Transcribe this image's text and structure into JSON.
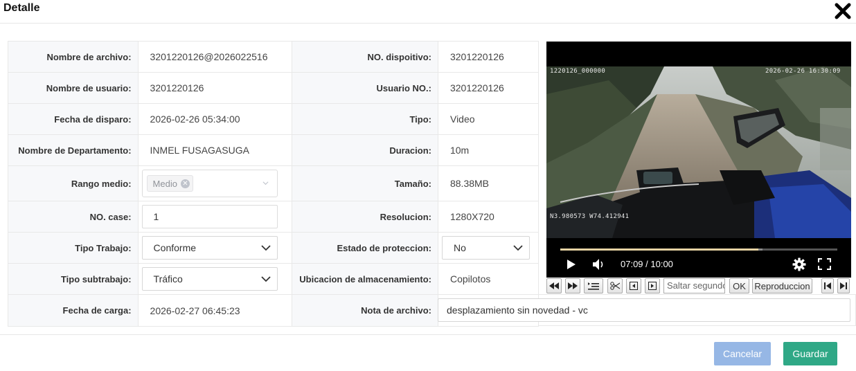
{
  "dialog": {
    "title": "Detalle",
    "close_icon": "close-x-icon"
  },
  "labels": {
    "file_name": "Nombre de archivo:",
    "device_no": "NO. dispoitivo:",
    "user_name": "Nombre de usuario:",
    "user_no": "Usuario NO.:",
    "shot_date": "Fecha de disparo:",
    "type": "Tipo:",
    "department": "Nombre de Departamento:",
    "duration": "Duracion:",
    "media_range": "Rango medio:",
    "size": "Tamaño:",
    "case_no": "NO. case:",
    "resolution": "Resolucion:",
    "work_type": "Tipo Trabajo:",
    "protection": "Estado de proteccion:",
    "subwork_type": "Tipo subtrabajo:",
    "storage": "Ubicacion de almacenamiento:",
    "upload_date": "Fecha de carga:",
    "file_note": "Nota de archivo:"
  },
  "values": {
    "file_name": "3201220126@2026022516",
    "device_no": "3201220126",
    "user_name": "3201220126",
    "user_no": "3201220126",
    "shot_date": "2026-02-26 05:34:00",
    "type": "Video",
    "department": "INMEL FUSAGASUGA",
    "duration": "10m",
    "media_range_tag": "Medio",
    "size": "88.38MB",
    "case_no": "1",
    "resolution": "1280X720",
    "work_type": "Conforme",
    "protection": "No",
    "subwork_type": "Tráfico",
    "storage": "Copilotos",
    "upload_date": "2026-02-27 06:45:23",
    "file_note": "desplazamiento sin novedad - vc"
  },
  "player": {
    "osd_top_left": "1220126_000000",
    "osd_top_right": "2026-02-26 16:30:09",
    "osd_bottom_left": "N3.980573  W74.412941",
    "time": "07:09 / 10:00",
    "progress": 0.715,
    "buffered": 0.73
  },
  "toolbar": {
    "jump_placeholder": "Saltar segundos",
    "ok": "OK",
    "playback": "Reproduccion"
  },
  "footer": {
    "cancel": "Cancelar",
    "save": "Guardar"
  },
  "colors": {
    "save": "#2fa886",
    "cancel": "#96b7e5",
    "label_bg": "#f7f8fa"
  }
}
